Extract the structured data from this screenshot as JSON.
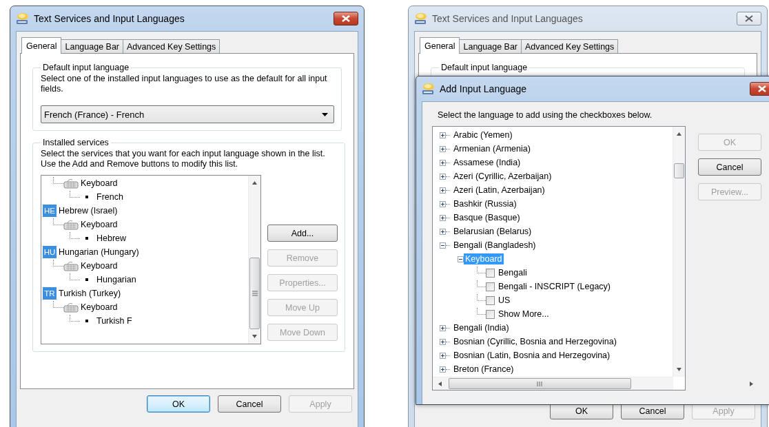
{
  "windows": [
    {
      "kind": "main",
      "title": "Text Services and Input Languages",
      "active": true,
      "tabs": [
        {
          "label": "General",
          "selected": true
        },
        {
          "label": "Language Bar",
          "selected": false
        },
        {
          "label": "Advanced Key Settings",
          "selected": false
        }
      ],
      "default_group": {
        "legend": "Default input language",
        "description": "Select one of the installed input languages to use as the default for all input fields.",
        "dropdown_value": "French (France) - French"
      },
      "services_group": {
        "legend": "Installed services",
        "description": "Select the services that you want for each input language shown in the list. Use the Add and Remove buttons to modify this list.",
        "tree": [
          {
            "kind": "keyboard",
            "label": "Keyboard",
            "children": [
              {
                "kind": "layout",
                "label": "French"
              }
            ]
          },
          {
            "kind": "language",
            "badge": "HE",
            "label": "Hebrew (Israel)",
            "children": [
              {
                "kind": "keyboard",
                "label": "Keyboard",
                "children": [
                  {
                    "kind": "layout",
                    "label": "Hebrew"
                  }
                ]
              }
            ]
          },
          {
            "kind": "language",
            "badge": "HU",
            "label": "Hungarian (Hungary)",
            "children": [
              {
                "kind": "keyboard",
                "label": "Keyboard",
                "children": [
                  {
                    "kind": "layout",
                    "label": "Hungarian"
                  }
                ]
              }
            ]
          },
          {
            "kind": "language",
            "badge": "TR",
            "label": "Turkish (Turkey)",
            "children": [
              {
                "kind": "keyboard",
                "label": "Keyboard",
                "children": [
                  {
                    "kind": "layout",
                    "label": "Turkish F"
                  }
                ]
              }
            ]
          }
        ],
        "buttons": [
          {
            "label": "Add...",
            "disabled": false
          },
          {
            "label": "Remove",
            "disabled": true
          },
          {
            "label": "Properties...",
            "disabled": true
          },
          {
            "label": "Move Up",
            "disabled": true
          },
          {
            "label": "Move Down",
            "disabled": true
          }
        ]
      },
      "footer_buttons": [
        {
          "label": "OK",
          "default": true,
          "disabled": false
        },
        {
          "label": "Cancel",
          "default": false,
          "disabled": false
        },
        {
          "label": "Apply",
          "default": false,
          "disabled": true
        }
      ]
    },
    {
      "kind": "background",
      "title": "Text Services and Input Languages",
      "active": false,
      "tabs": [
        {
          "label": "General",
          "selected": true
        },
        {
          "label": "Language Bar",
          "selected": false
        },
        {
          "label": "Advanced Key Settings",
          "selected": false
        }
      ],
      "default_group": {
        "legend": "Default input language"
      },
      "footer_buttons": [
        {
          "label": "OK",
          "default": false,
          "disabled": false
        },
        {
          "label": "Cancel",
          "default": false,
          "disabled": false
        },
        {
          "label": "Apply",
          "default": false,
          "disabled": true
        }
      ]
    }
  ],
  "dialog": {
    "title": "Add Input Language",
    "active": true,
    "instruction": "Select the language to add using the checkboxes below.",
    "tree": [
      {
        "kind": "language",
        "label": "Arabic (Yemen)",
        "expanded": false,
        "selected": false
      },
      {
        "kind": "language",
        "label": "Armenian (Armenia)",
        "expanded": false,
        "selected": false
      },
      {
        "kind": "language",
        "label": "Assamese (India)",
        "expanded": false,
        "selected": false
      },
      {
        "kind": "language",
        "label": "Azeri (Cyrillic, Azerbaijan)",
        "expanded": false,
        "selected": false
      },
      {
        "kind": "language",
        "label": "Azeri (Latin, Azerbaijan)",
        "expanded": false,
        "selected": false
      },
      {
        "kind": "language",
        "label": "Bashkir (Russia)",
        "expanded": false,
        "selected": false
      },
      {
        "kind": "language",
        "label": "Basque (Basque)",
        "expanded": false,
        "selected": false
      },
      {
        "kind": "language",
        "label": "Belarusian (Belarus)",
        "expanded": false,
        "selected": false
      },
      {
        "kind": "language",
        "label": "Bengali (Bangladesh)",
        "expanded": true,
        "selected": false,
        "children": [
          {
            "kind": "group",
            "label": "Keyboard",
            "expanded": true,
            "selected": true,
            "children": [
              {
                "kind": "option",
                "label": "Bengali",
                "checked": false,
                "selected": false
              },
              {
                "kind": "option",
                "label": "Bengali - INSCRIPT (Legacy)",
                "checked": false,
                "selected": false
              },
              {
                "kind": "option",
                "label": "US",
                "checked": false,
                "selected": false
              },
              {
                "kind": "option",
                "label": "Show More...",
                "checked": false,
                "selected": false
              }
            ]
          }
        ]
      },
      {
        "kind": "language",
        "label": "Bengali (India)",
        "expanded": false,
        "selected": false
      },
      {
        "kind": "language",
        "label": "Bosnian (Cyrillic, Bosnia and Herzegovina)",
        "expanded": false,
        "selected": false
      },
      {
        "kind": "language",
        "label": "Bosnian (Latin, Bosnia and Herzegovina)",
        "expanded": false,
        "selected": false
      },
      {
        "kind": "language",
        "label": "Breton (France)",
        "expanded": false,
        "selected": false
      }
    ],
    "buttons": [
      {
        "label": "OK",
        "disabled": true
      },
      {
        "label": "Cancel",
        "disabled": false
      },
      {
        "label": "Preview...",
        "disabled": true
      }
    ]
  }
}
